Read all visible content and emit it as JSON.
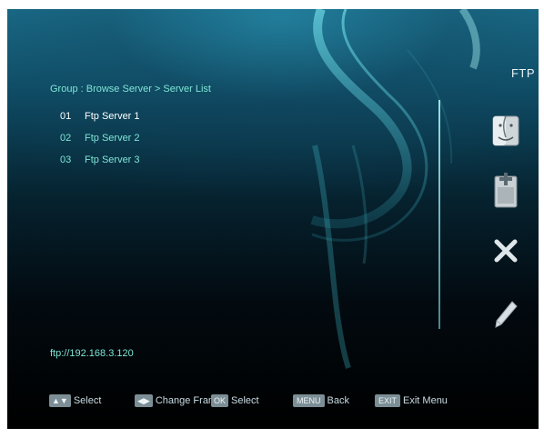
{
  "app_title": "FTP",
  "breadcrumb": "Group : Browse Server > Server List",
  "servers": [
    {
      "num": "01",
      "name": "Ftp Server 1"
    },
    {
      "num": "02",
      "name": "Ftp Server 2"
    },
    {
      "num": "03",
      "name": "Ftp Server 3"
    }
  ],
  "ftp_address": "ftp://192.168.3.120",
  "footer": {
    "select_label": "Select",
    "change_frame_label": "Change Fram",
    "ok_key": "OK",
    "ok_select_label": "Select",
    "menu_key": "MENU",
    "back_label": "Back",
    "exit_key": "EXIT",
    "exit_menu_label": "Exit Menu"
  },
  "icons": {
    "finder": "finder-icon",
    "add": "add-file-icon",
    "delete": "delete-x-icon",
    "edit": "pencil-icon"
  },
  "colors": {
    "highlight_text": "#ffffff",
    "list_text": "#7fe6d6",
    "background_top": "#1a6f8c",
    "background_bottom": "#000000"
  }
}
